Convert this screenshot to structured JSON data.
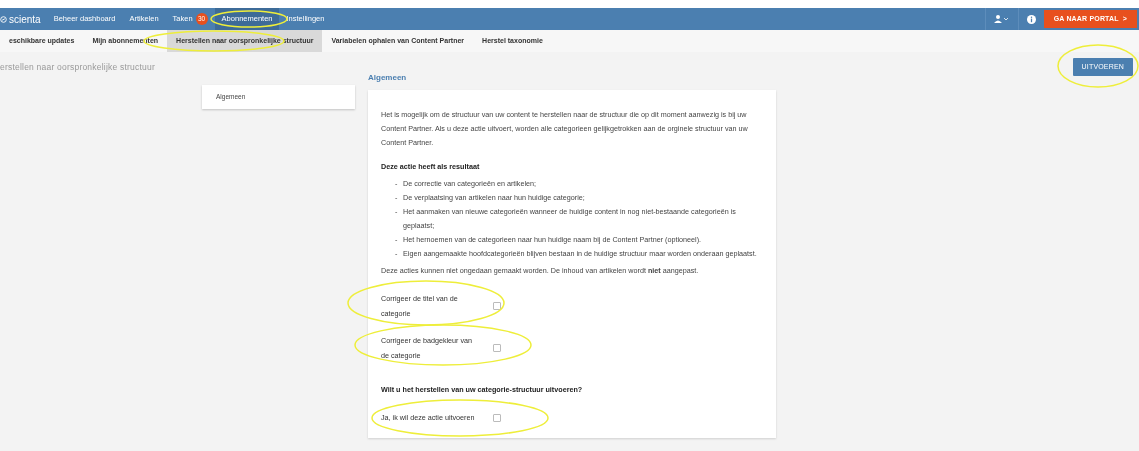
{
  "navbar": {
    "logo": "scienta",
    "items": [
      {
        "label": "Beheer dashboard",
        "selected": false
      },
      {
        "label": "Artikelen",
        "selected": false
      },
      {
        "label": "Taken",
        "badge": "30",
        "selected": false
      },
      {
        "label": "Abonnementen",
        "selected": true
      },
      {
        "label": "Instellingen",
        "selected": false
      }
    ],
    "portal_button": "GA NAAR PORTAL",
    "portal_chevron": ">"
  },
  "subnav": [
    {
      "label": "eschikbare updates",
      "selected": false
    },
    {
      "label": "Mijn abonnementen",
      "selected": false
    },
    {
      "label": "Herstellen naar oorspronkelijke structuur",
      "selected": true
    },
    {
      "label": "Variabelen ophalen van Content Partner",
      "selected": false
    },
    {
      "label": "Herstel taxonomie",
      "selected": false
    }
  ],
  "page_title": "erstellen naar oorspronkelijke structuur",
  "run_button": "UITVOEREN",
  "side_menu": [
    {
      "label": "Algemeen",
      "selected": true
    }
  ],
  "section": {
    "heading": "Algemeen",
    "intro": "Het is mogelijk om de structuur van uw content te herstellen naar de structuur die op dit moment aanwezig is bij uw Content Partner. Als u deze actie uitvoert, worden alle categorieen gelijkgetrokken aan de orginele structuur van uw Content Partner.",
    "result_heading": "Deze actie heeft als resultaat",
    "results": [
      {
        "marker": "-",
        "text": "De correctie van categorieën en artikelen;"
      },
      {
        "marker": "-",
        "text": "De verplaatsing van artikelen naar hun huidige categorie;"
      },
      {
        "marker": "-",
        "text": "Het aanmaken van nieuwe categorieën wanneer de huidige content in nog niet-bestaande categorieën is geplaatst;"
      },
      {
        "marker": "-",
        "text": "Het hernoemen van de categorieen naar hun huidige naam bij de Content Partner (optioneel)."
      },
      {
        "marker": "-",
        "text": "Eigen aangemaakte hoofdcategorieën blijven bestaan in de huidige structuur maar worden onderaan geplaatst."
      }
    ],
    "warning": "Deze acties kunnen niet ongedaan gemaakt worden. De inhoud van artikelen wordt **niet** aangepast.",
    "options": [
      {
        "label": "Corrigeer de titel van de categorie",
        "checked": false
      },
      {
        "label": "Corrigeer de badgekleur van de categorie",
        "checked": false
      }
    ],
    "confirm_question": "Wilt u het herstellen van uw categorie-structuur uitvoeren?",
    "confirm": {
      "label": "Ja, ik wil deze actie uitvoeren",
      "checked": false
    }
  }
}
